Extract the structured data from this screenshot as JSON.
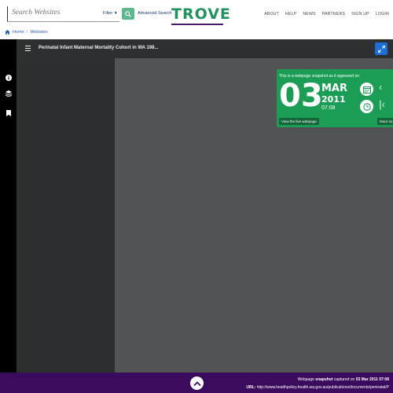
{
  "header": {
    "search_placeholder": "Search Websites",
    "filter_label": "Filter",
    "advanced_search_label": "Advanced Search",
    "logo_text": "TROVE",
    "nav": [
      "ABOUT",
      "HELP",
      "NEWS",
      "PARTNERS",
      "SIGN UP",
      "LOGIN"
    ]
  },
  "breadcrumb": {
    "home": "Home",
    "sep": "/",
    "current": "Websites"
  },
  "viewer": {
    "title": "Perinatal Infant Maternal Mortality Cohort in WA 198..."
  },
  "snapshot": {
    "heading": "This is a webpage snapshot as it appeared on",
    "day": "03",
    "month": "MAR",
    "year": "2011",
    "time": "07:08",
    "live_label": "View the live webpage",
    "more_label": "More sn"
  },
  "footer": {
    "prefix": "Webpage",
    "bold_word": "snapshot",
    "captured": "captured on",
    "date": "03 Mar 2011 07:08",
    "url_label": "URL:",
    "url": "http://www.healthpolicy.health.wa.gov.au/publications/documents/perinatal/P"
  },
  "colors": {
    "brand_green": "#22935f",
    "brand_purple": "#3a0b5c",
    "snapshot_green": "#1b9d55",
    "expand_blue": "#1d6fd8"
  }
}
